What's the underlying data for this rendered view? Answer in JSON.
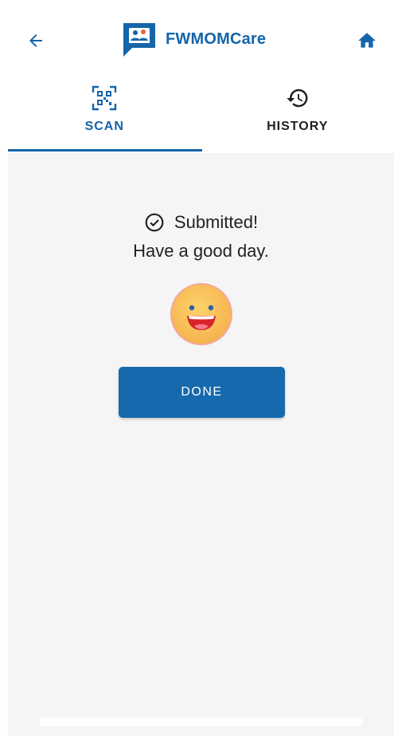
{
  "header": {
    "app_name": "FWMOMCare",
    "back_icon": "arrow-left-icon",
    "home_icon": "home-icon"
  },
  "tabs": [
    {
      "label": "SCAN",
      "icon": "qr-code-icon",
      "active": true
    },
    {
      "label": "HISTORY",
      "icon": "history-icon",
      "active": false
    }
  ],
  "main": {
    "status_title": "Submitted!",
    "status_subtitle": "Have a good day.",
    "status_icon": "check-circle-icon",
    "emoji": "smiley-face-icon",
    "done_label": "DONE"
  },
  "colors": {
    "accent": "#1565a9",
    "button": "#1769ad",
    "content_bg": "#f5f5f5"
  }
}
